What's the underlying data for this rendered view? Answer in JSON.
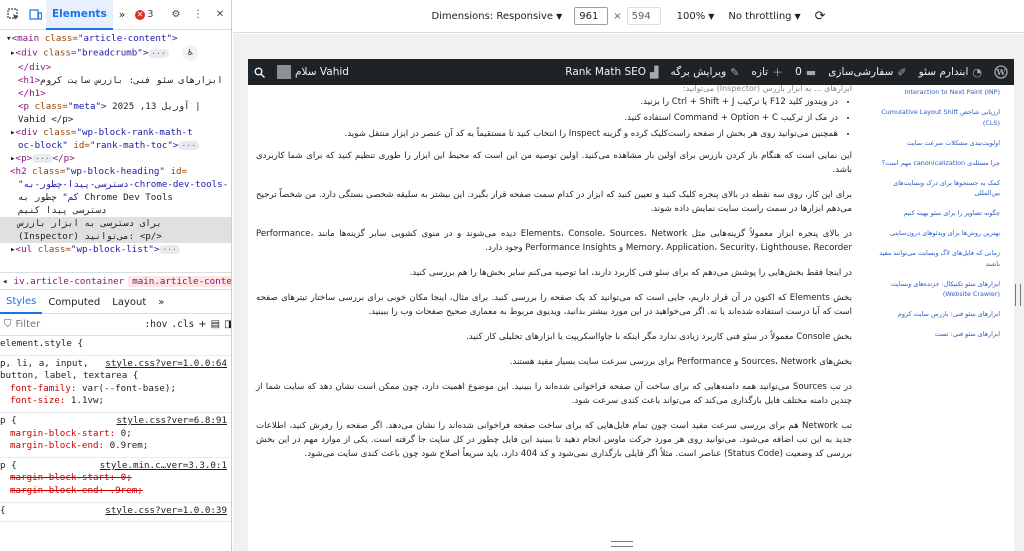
{
  "devtools": {
    "tabs": {
      "elements": "Elements",
      "more": "»"
    },
    "error_count": "3",
    "tree": {
      "l1_tag": "<main",
      "l1_attr": "class=",
      "l1_val": "\"article-content\">",
      "l2_tag": "<div",
      "l2_attr": "class=",
      "l2_val": "\"breadcrumb\">",
      "l3_tag": "</div>",
      "l4_tag": "<h1>",
      "l4_text": "ابزارهای سئو فنی: بازرس سایت کروم",
      "l5_tag": "</h1>",
      "l6_tag": "<p",
      "l6_attr": "class=",
      "l6_val": "\"meta\">",
      "l6_text": "2025 ,13 آوریل |",
      "l7_text": "Vahid </p>",
      "l8_tag": "<div",
      "l8_attr": "class=",
      "l8_val": "\"wp-block-rank-math-t",
      "l9_val": "oc-block\"",
      "l9_attr": "id=",
      "l9_val2": "\"rank-math-toc\">",
      "l10_tag": "<p>",
      "l10_end": "</p>",
      "l11_tag": "<h2",
      "l11_attr": "class=",
      "l11_val": "\"wp-block-heading\"",
      "l11_attr2": "id=",
      "l12_val": "\"دسترسی-پیدا-چطور-به-chrome-dev-tools-",
      "l13_val": "کم\"",
      "l13_text": "چطور به Chrome Dev Tools",
      "l14_text": "دسترسی پیدا کنیم",
      "l15_text": "برای دسترسی به ابزار بازرس",
      "l16_text": "(Inspector) می‌توانید: <p/>",
      "l17_tag": "<ul",
      "l17_attr": "class=",
      "l17_val": "\"wp-block-list\">"
    },
    "breadcrumbs": [
      "iv.article-container",
      "main.article-content",
      "p"
    ],
    "styles_tabs": [
      "Styles",
      "Computed",
      "Layout",
      "»"
    ],
    "filter_placeholder": "Filter",
    "filter_hov": ":hov",
    "filter_cls": ".cls",
    "rules": [
      {
        "selector": "element.style {",
        "source": "",
        "props": []
      },
      {
        "selector": "p, li, a, input,",
        "selector2": "button, label, textarea {",
        "source": "style.css?ver=1.0.0:64",
        "props": [
          {
            "name": "font-family",
            "value": "var(--font-base);"
          },
          {
            "name": "font-size",
            "value": "1.1vw;"
          }
        ]
      },
      {
        "selector": "p {",
        "source": "style.css?ver=6.8:91",
        "props": [
          {
            "name": "margin-block-start",
            "value": "0;"
          },
          {
            "name": "margin-block-end",
            "value": "0.9rem;"
          }
        ]
      },
      {
        "selector": "p {",
        "source": "style.min.c…ver=3.3.0:1",
        "props": [
          {
            "name": "margin-block-start",
            "value": "0;"
          },
          {
            "name": "margin-block-end",
            "value": ".9rem;"
          }
        ]
      },
      {
        "selector": "{",
        "source": "style.css?ver=1.0.0:39",
        "props": []
      }
    ]
  },
  "device_toolbar": {
    "dimensions_label": "Dimensions: Responsive",
    "width": "961",
    "times": "×",
    "height": "594",
    "zoom": "100%",
    "throttle": "No throttling"
  },
  "admin_bar": {
    "wp_logo": "wordpress-logo",
    "site_name": "ابندارم سئو",
    "customize": "سفارشی‌سازی",
    "comments_count": "0",
    "new_label": "تازه",
    "edit_label": "ویرایش برگه",
    "rank_math": "Rank Math SEO",
    "greeting": "سلام Vahid"
  },
  "article": {
    "top_faded": "ابزارهای ... به ابزار بازرس (Inspector) می‌توانید:",
    "list": [
      "در ویندوز کلید F12 یا ترکیب Ctrl + Shift + J را بزنید.",
      "در مک از ترکیب Command + Option + C استفاده کنید.",
      "همچنین می‌توانید روی هر بخش از صفحه راست‌کلیک کرده و گزینه Inspect را انتخاب کنید تا مستقیماً به کد آن عنصر در ابزار منتقل شوید."
    ],
    "paragraphs": [
      "این نمایی است که هنگام باز کردن بازرس برای اولین بار مشاهده می‌کنید. اولین توصیه من این است که محیط این ابزار را طوری تنظیم کنید که برای شما کاربردی باشد.",
      "برای این کار، روی سه نقطه در بالای پنجره کلیک کنید و تعیین کنید که ابزار در کدام سمت صفحه قرار بگیرد. این بیشتر به سلیقه شخصی بستگی دارد. من شخصاً ترجیح می‌دهم ابزارها در سمت راست سایت نمایش داده شوند.",
      "در بالای پنجره ابزار معمولاً گزینه‌هایی مثل Elements، Console، Sources، Network دیده می‌شوند و در منوی کشویی سایر گزینه‌ها مانند Performance، Memory، Application، Security، Lighthouse، Recorder و Performance Insights وجود دارد.",
      "در اینجا فقط بخش‌هایی را پوشش می‌دهم که برای سئو فنی کاربرد دارند، اما توصیه می‌کنم سایر بخش‌ها را هم بررسی کنید.",
      "بخش Elements که اکنون در آن قرار داریم، جایی است که می‌توانید کد یک صفحه را بررسی کنید. برای مثال، اینجا مکان خوبی برای بررسی ساختار تیترهای صفحه است که آیا درست استفاده شده‌اند یا نه. اگر می‌خواهید در این مورد بیشتر بدانید، ویدیوی مربوط به معماری صحیح صفحات وب را ببینید.",
      "بخش Console معمولاً در سئو فنی کاربرد زیادی ندارد مگر اینکه با جاوااسکریپت یا ابزارهای تحلیلی کار کنید.",
      "بخش‌های Sources، Network و Performance برای بررسی سرعت سایت بسیار مفید هستند.",
      "در تب Sources می‌توانید همه دامنه‌هایی که برای ساخت آن صفحه فراخوانی شده‌اند را ببینید. این موضوع اهمیت دارد، چون ممکن است نشان دهد که سایت شما از چندین دامنه مختلف فایل بارگذاری می‌کند که می‌تواند باعث کندی سرعت شود.",
      "تب Network هم برای بررسی سرعت مفید است چون تمام فایل‌هایی که برای ساخت صفحه فراخوانی شده‌اند را نشان می‌دهد. اگر صفحه را رفرش کنید، اطلاعات جدید به این تب اضافه می‌شود. می‌توانید روی هر مورد حرکت ماوس انجام دهید تا ببینید این فایل چطور در کل سایت جا گرفته است. یکی از موارد مهم در این بخش بررسی کد وضعیت (Status Code) عناصر است. مثلاً اگر فایلی بارگذاری نمی‌شود و کد 404 دارد، باید سریعاً اصلاح شود چون باعث کندی سایت می‌شود."
    ]
  },
  "toc": [
    "Interaction to Next Paint (INP)",
    "ارزیابی شاخص Cumulative Layout Shift (CLS)",
    "اولویت‌بندی مشکلات سرعت سایت",
    "چرا مسئله‌ی canonicalization مهم است؟",
    "کمک به جستجوها برای درک وبسایت‌های بین‌المللی",
    "چگونه تصاویر را برای سئو بهینه کنیم",
    "بهترین روش‌ها برای ویدئوهای درون‌سایتی",
    "زمانی که فایل‌های لاگ وبسایت می‌توانند مفید باشند",
    "ابزارهای سئو تکنیکال: خزنده‌های وبسایت (Website Crawler)",
    "ابزارهای سئو فنی: بازرس سایت کروم",
    "ابزارهای سئو فنی: تست"
  ]
}
